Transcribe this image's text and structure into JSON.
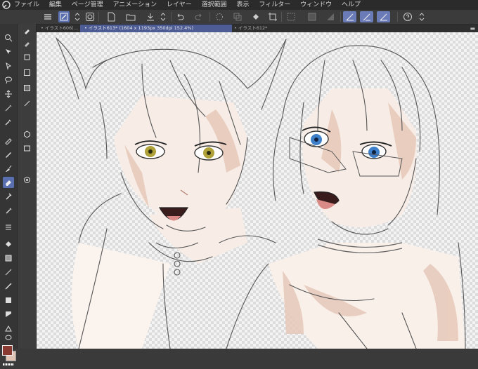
{
  "menubar": {
    "items": [
      "ファイル",
      "編集",
      "ページ管理",
      "アニメーション",
      "レイヤー",
      "選択範囲",
      "表示",
      "フィルター",
      "ウィンドウ",
      "ヘルプ"
    ]
  },
  "tabs": [
    {
      "label": "イラスト606(…"
    },
    {
      "label": "イラスト613* (1604 x 1193px 350dpi 152.4%)"
    },
    {
      "label": "イラスト612*"
    }
  ],
  "colors": {
    "accent": "#5a6fb0",
    "main_color": "#8b3a32",
    "sub_color": "#e0c4b6"
  },
  "artwork": {
    "description_icon": "artwork-canvas"
  }
}
